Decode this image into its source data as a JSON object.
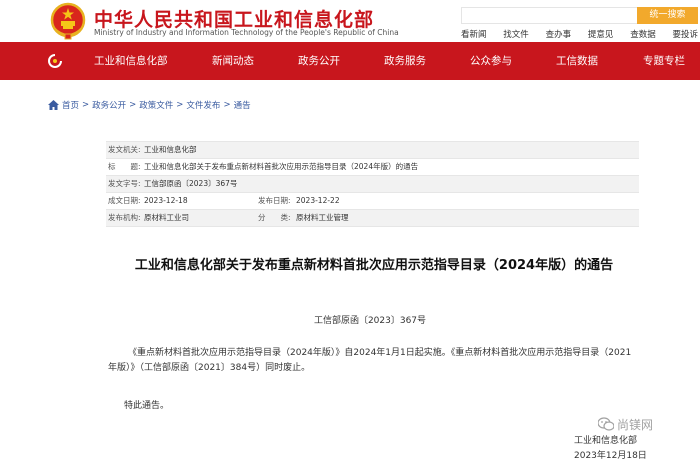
{
  "header": {
    "site_title": "中华人民共和国工业和信息化部",
    "site_subtitle": "Ministry of Industry and Information Technology of the People's Republic of China",
    "search": {
      "placeholder": "",
      "button_label": "统一搜索"
    },
    "quick_links": [
      "看新闻",
      "找文件",
      "查办事",
      "提意见",
      "查数据",
      "要投诉"
    ]
  },
  "nav": {
    "items": [
      "工业和信息化部",
      "新闻动态",
      "政务公开",
      "政务服务",
      "公众参与",
      "工信数据",
      "专题专栏"
    ]
  },
  "breadcrumb": [
    "首页",
    "政务公开",
    "政策文件",
    "文件发布",
    "通告"
  ],
  "meta": {
    "issuer_label": "发文机关:",
    "issuer": "工业和信息化部",
    "title_label": "标　　题:",
    "title": "工业和信息化部关于发布重点新材料首批次应用示范指导目录（2024年版）的通告",
    "doc_no_label": "发文字号:",
    "doc_no": "工信部原函〔2023〕367号",
    "created_label": "成文日期:",
    "created": "2023-12-18",
    "published_label": "发布日期:",
    "published": "2023-12-22",
    "dept_label": "发布机构:",
    "dept": "原材料工业司",
    "category_label": "分　　类:",
    "category": "原材料工业管理"
  },
  "article": {
    "title": "工业和信息化部关于发布重点新材料首批次应用示范指导目录（2024年版）的通告",
    "doc_number": "工信部原函〔2023〕367号",
    "body": "《重点新材料首批次应用示范指导目录（2024年版）》自2024年1月1日起实施。《重点新材料首批次应用示范指导目录（2021年版）》（工信部原函〔2021〕384号）同时废止。",
    "notice": "特此通告。",
    "signature_org": "工业和信息化部",
    "signature_date": "2023年12月18日"
  },
  "watermark": {
    "text": "尚镁网"
  },
  "colors": {
    "brand_red": "#c8161d",
    "search_orange": "#f2a92c",
    "link_blue": "#3a5ba0"
  }
}
